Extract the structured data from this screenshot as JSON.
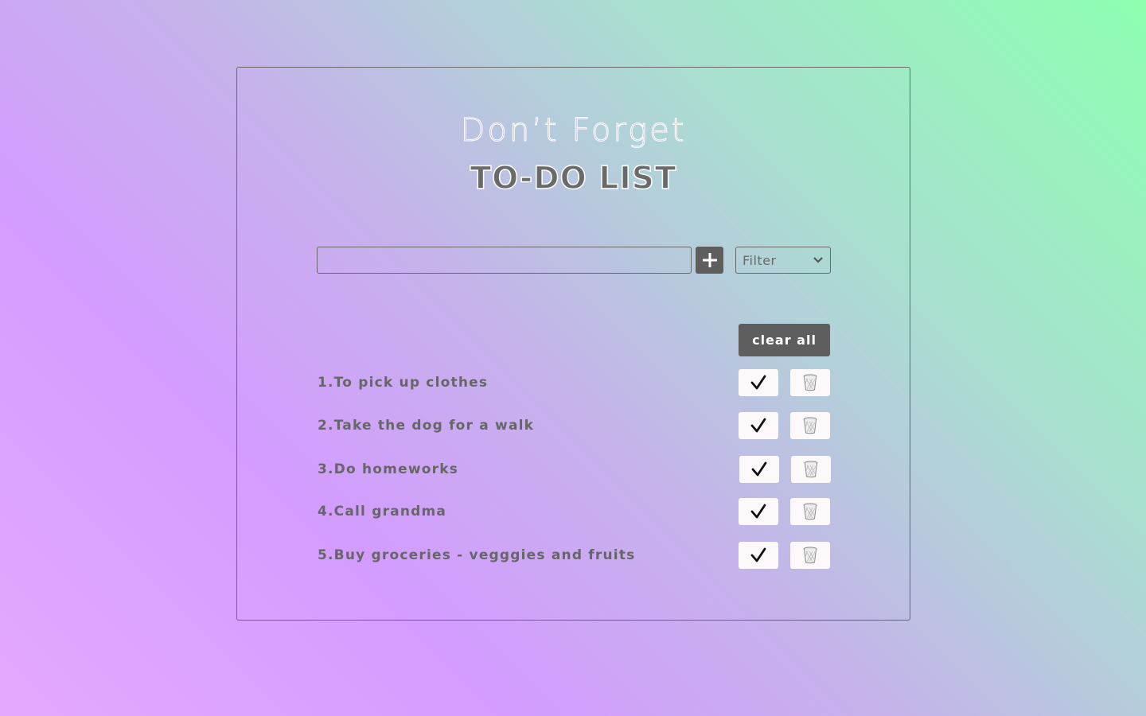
{
  "header": {
    "title": "Don’t Forget",
    "subtitle": "TO-DO LIST"
  },
  "form": {
    "input_value": "",
    "add_icon": "plus-icon",
    "filter_selected": "Filter",
    "filter_icon": "chevron-down-icon"
  },
  "actions": {
    "clear_all_label": "clear all"
  },
  "todos": [
    {
      "text": "1.To pick up clothes"
    },
    {
      "text": "2.Take the dog for a walk"
    },
    {
      "text": "3.Do homeworks"
    },
    {
      "text": "4.Call grandma"
    },
    {
      "text": "5.Buy groceries - vegggies and fruits"
    }
  ],
  "icons": {
    "complete": "checkmark-icon",
    "delete": "trash-icon"
  },
  "colors": {
    "button_dark": "#5e5e5e",
    "text_gray": "#666666",
    "border": "#6a6a6a",
    "item_button_bg": "#fdf9fb",
    "gradient_start": "#e4a8ff",
    "gradient_end": "#8dffb0"
  }
}
